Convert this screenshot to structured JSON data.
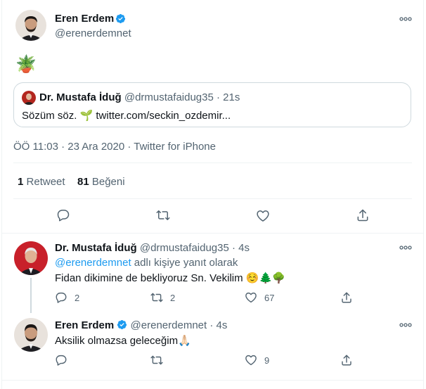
{
  "main_tweet": {
    "author_name": "Eren Erdem",
    "handle": "@erenerdemnet",
    "emoji_text": "🪴",
    "quoted": {
      "author_name": "Dr. Mustafa İduğ",
      "handle": "@drmustafaidug35",
      "dot": "·",
      "time": "21s",
      "text": "Sözüm söz. ",
      "emoji": "🌱",
      "link": "twitter.com/seckin_ozdemir..."
    },
    "meta": {
      "time": "ÖÖ 11:03",
      "date": "23 Ara 2020",
      "source": "Twitter for iPhone",
      "dot": "·"
    },
    "stats": {
      "retweets_count": "1",
      "retweets_label": "Retweet",
      "likes_count": "81",
      "likes_label": "Beğeni"
    }
  },
  "reply_1": {
    "author_name": "Dr. Mustafa İduğ",
    "handle": "@drmustafaidug35",
    "dot": "·",
    "time": "4s",
    "reply_to_handle": "@erenerdemnet",
    "reply_to_suffix": " adlı kişiye yanıt olarak",
    "text": "Fidan dikimine de bekliyoruz Sn. Vekilim ",
    "emojis": "☺️🌲🌳",
    "replies": "2",
    "retweets": "2",
    "likes": "67"
  },
  "reply_2": {
    "author_name": "Eren Erdem",
    "handle": "@erenerdemnet",
    "dot": "·",
    "time": "4s",
    "text": "Aksilik olmazsa geleceğim",
    "emoji": "🙏🏻",
    "replies": "",
    "retweets": "",
    "likes": "9"
  },
  "colors": {
    "accent": "#1d9bf0",
    "muted": "#536471",
    "border": "#eff3f4"
  }
}
